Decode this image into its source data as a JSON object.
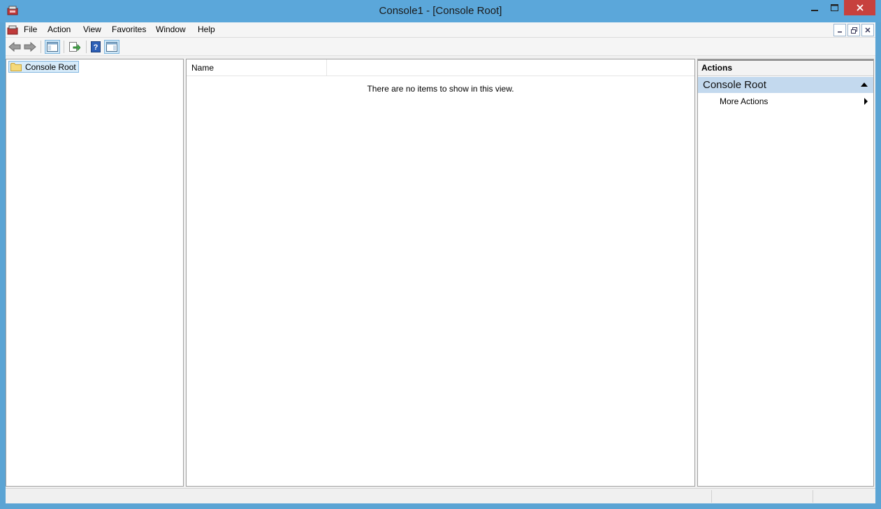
{
  "window": {
    "title": "Console1 - [Console Root]",
    "close_color": "#c7413e",
    "titlebar_color": "#5ba7da"
  },
  "menubar": {
    "items": [
      "File",
      "Action",
      "View",
      "Favorites",
      "Window",
      "Help"
    ]
  },
  "toolbar": {
    "buttons": [
      "back-arrow-icon",
      "forward-arrow-icon",
      "show-hide-console-tree-icon",
      "export-list-icon",
      "help-icon",
      "show-hide-action-pane-icon"
    ]
  },
  "tree": {
    "root_label": "Console Root"
  },
  "list": {
    "column_name": "Name",
    "empty_message": "There are no items to show in this view."
  },
  "actions": {
    "header": "Actions",
    "section_title": "Console Root",
    "items": [
      "More Actions"
    ]
  }
}
